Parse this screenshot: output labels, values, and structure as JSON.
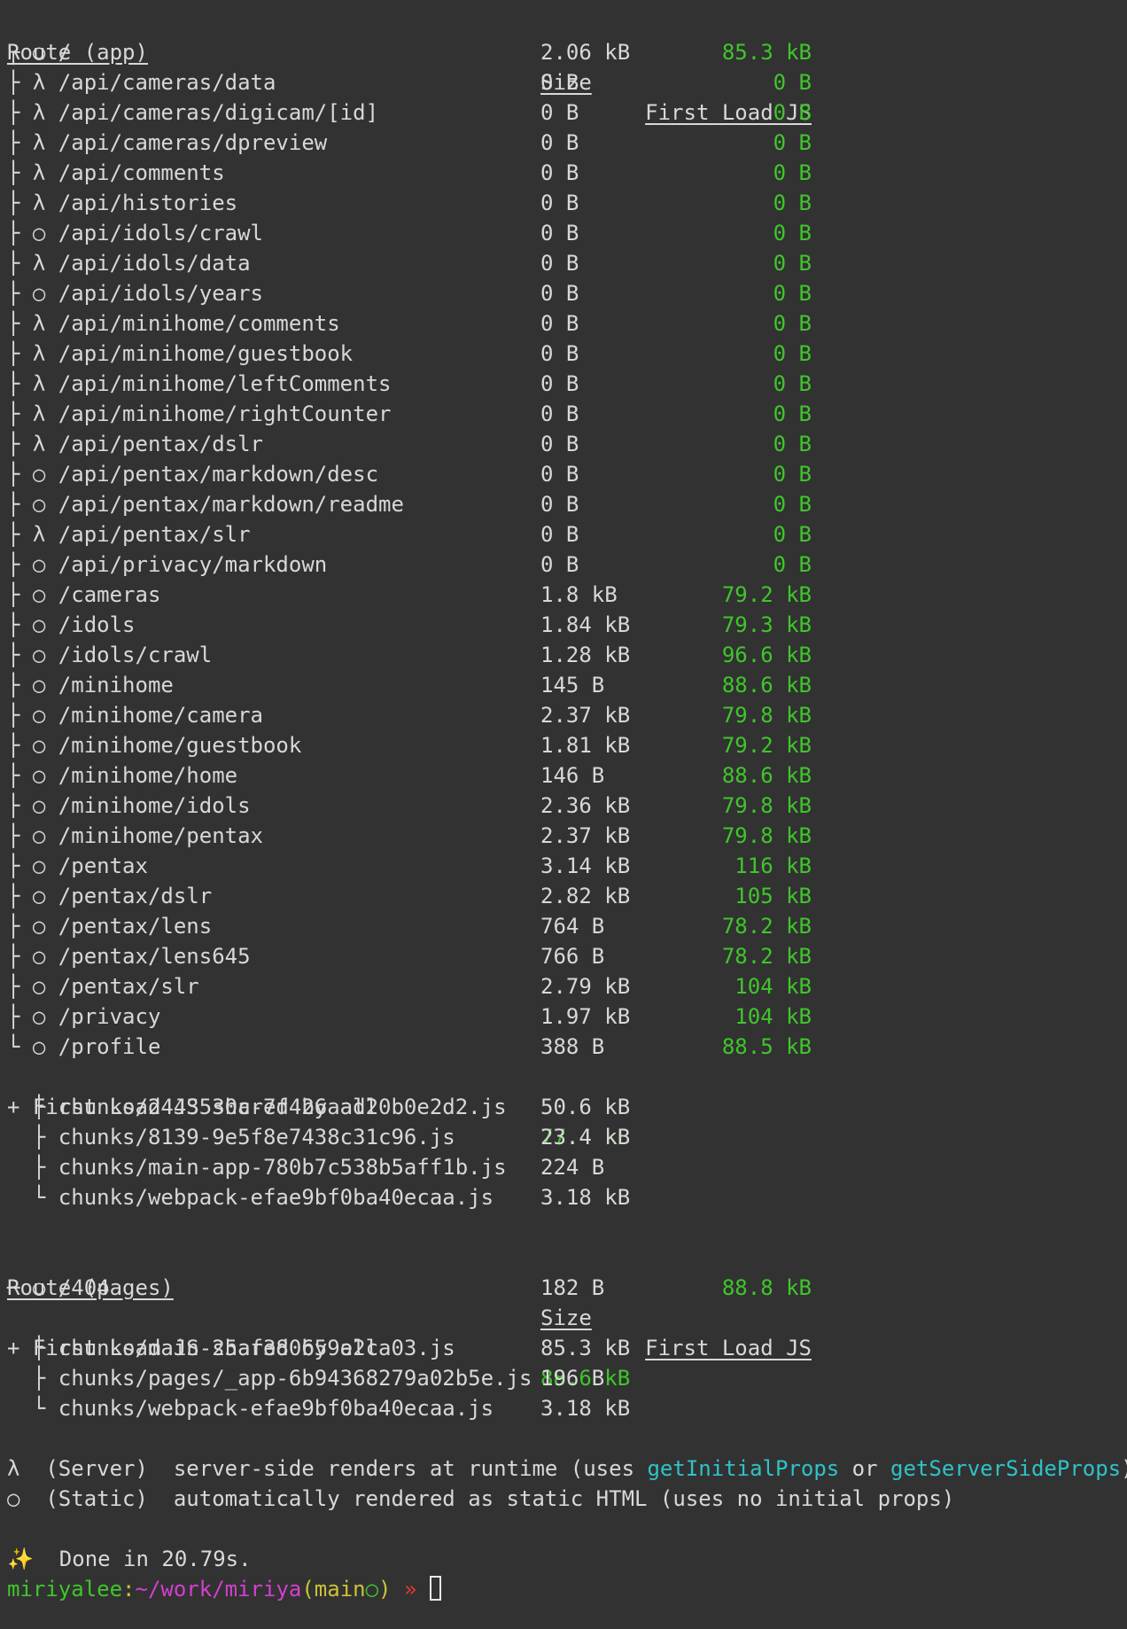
{
  "app_routes": {
    "header": {
      "route": "Route (app)",
      "size": "Size",
      "first_load": "First Load JS"
    },
    "rows": [
      {
        "prefix": "┌ ○ ",
        "path": "/",
        "size": "2.06 kB",
        "first_load": "85.3 kB"
      },
      {
        "prefix": "├ λ ",
        "path": "/api/cameras/data",
        "size": "0 B",
        "first_load": "0 B"
      },
      {
        "prefix": "├ λ ",
        "path": "/api/cameras/digicam/[id]",
        "size": "0 B",
        "first_load": "0 B"
      },
      {
        "prefix": "├ λ ",
        "path": "/api/cameras/dpreview",
        "size": "0 B",
        "first_load": "0 B"
      },
      {
        "prefix": "├ λ ",
        "path": "/api/comments",
        "size": "0 B",
        "first_load": "0 B"
      },
      {
        "prefix": "├ λ ",
        "path": "/api/histories",
        "size": "0 B",
        "first_load": "0 B"
      },
      {
        "prefix": "├ ○ ",
        "path": "/api/idols/crawl",
        "size": "0 B",
        "first_load": "0 B"
      },
      {
        "prefix": "├ λ ",
        "path": "/api/idols/data",
        "size": "0 B",
        "first_load": "0 B"
      },
      {
        "prefix": "├ ○ ",
        "path": "/api/idols/years",
        "size": "0 B",
        "first_load": "0 B"
      },
      {
        "prefix": "├ λ ",
        "path": "/api/minihome/comments",
        "size": "0 B",
        "first_load": "0 B"
      },
      {
        "prefix": "├ λ ",
        "path": "/api/minihome/guestbook",
        "size": "0 B",
        "first_load": "0 B"
      },
      {
        "prefix": "├ λ ",
        "path": "/api/minihome/leftComments",
        "size": "0 B",
        "first_load": "0 B"
      },
      {
        "prefix": "├ λ ",
        "path": "/api/minihome/rightCounter",
        "size": "0 B",
        "first_load": "0 B"
      },
      {
        "prefix": "├ λ ",
        "path": "/api/pentax/dslr",
        "size": "0 B",
        "first_load": "0 B"
      },
      {
        "prefix": "├ ○ ",
        "path": "/api/pentax/markdown/desc",
        "size": "0 B",
        "first_load": "0 B"
      },
      {
        "prefix": "├ ○ ",
        "path": "/api/pentax/markdown/readme",
        "size": "0 B",
        "first_load": "0 B"
      },
      {
        "prefix": "├ λ ",
        "path": "/api/pentax/slr",
        "size": "0 B",
        "first_load": "0 B"
      },
      {
        "prefix": "├ ○ ",
        "path": "/api/privacy/markdown",
        "size": "0 B",
        "first_load": "0 B"
      },
      {
        "prefix": "├ ○ ",
        "path": "/cameras",
        "size": "1.8 kB",
        "first_load": "79.2 kB"
      },
      {
        "prefix": "├ ○ ",
        "path": "/idols",
        "size": "1.84 kB",
        "first_load": "79.3 kB"
      },
      {
        "prefix": "├ ○ ",
        "path": "/idols/crawl",
        "size": "1.28 kB",
        "first_load": "96.6 kB"
      },
      {
        "prefix": "├ ○ ",
        "path": "/minihome",
        "size": "145 B",
        "first_load": "88.6 kB"
      },
      {
        "prefix": "├ ○ ",
        "path": "/minihome/camera",
        "size": "2.37 kB",
        "first_load": "79.8 kB"
      },
      {
        "prefix": "├ ○ ",
        "path": "/minihome/guestbook",
        "size": "1.81 kB",
        "first_load": "79.2 kB"
      },
      {
        "prefix": "├ ○ ",
        "path": "/minihome/home",
        "size": "146 B",
        "first_load": "88.6 kB"
      },
      {
        "prefix": "├ ○ ",
        "path": "/minihome/idols",
        "size": "2.36 kB",
        "first_load": "79.8 kB"
      },
      {
        "prefix": "├ ○ ",
        "path": "/minihome/pentax",
        "size": "2.37 kB",
        "first_load": "79.8 kB"
      },
      {
        "prefix": "├ ○ ",
        "path": "/pentax",
        "size": "3.14 kB",
        "first_load": "116 kB"
      },
      {
        "prefix": "├ ○ ",
        "path": "/pentax/dslr",
        "size": "2.82 kB",
        "first_load": "105 kB"
      },
      {
        "prefix": "├ ○ ",
        "path": "/pentax/lens",
        "size": "764 B",
        "first_load": "78.2 kB"
      },
      {
        "prefix": "├ ○ ",
        "path": "/pentax/lens645",
        "size": "766 B",
        "first_load": "78.2 kB"
      },
      {
        "prefix": "├ ○ ",
        "path": "/pentax/slr",
        "size": "2.79 kB",
        "first_load": "104 kB"
      },
      {
        "prefix": "├ ○ ",
        "path": "/privacy",
        "size": "1.97 kB",
        "first_load": "104 kB"
      },
      {
        "prefix": "└ ○ ",
        "path": "/profile",
        "size": "388 B",
        "first_load": "88.5 kB"
      }
    ],
    "shared": {
      "label": "+ First Load JS shared by all",
      "size": "77.4 kB"
    },
    "chunks": [
      {
        "prefix": "  ├ ",
        "name": "chunks/2443530c-7f426aad20b0e2d2.js",
        "size": "50.6 kB"
      },
      {
        "prefix": "  ├ ",
        "name": "chunks/8139-9e5f8e7438c31c96.js",
        "size": "23.4 kB"
      },
      {
        "prefix": "  ├ ",
        "name": "chunks/main-app-780b7c538b5aff1b.js",
        "size": "224 B"
      },
      {
        "prefix": "  └ ",
        "name": "chunks/webpack-efae9bf0ba40ecaa.js",
        "size": "3.18 kB"
      }
    ]
  },
  "pages_routes": {
    "header": {
      "route": "Route (pages)",
      "size": "Size",
      "first_load": "First Load JS"
    },
    "rows": [
      {
        "prefix": "─ ○ ",
        "path": "/404",
        "size": "182 B",
        "first_load": "88.8 kB"
      }
    ],
    "shared": {
      "label": "+ First Load JS shared by all",
      "size": "88.6 kB"
    },
    "chunks": [
      {
        "prefix": "  ├ ",
        "name": "chunks/main-25af380659e2ca03.js",
        "size": "85.3 kB"
      },
      {
        "prefix": "  ├ ",
        "name": "chunks/pages/_app-6b94368279a02b5e.js",
        "size": "196 B"
      },
      {
        "prefix": "  └ ",
        "name": "chunks/webpack-efae9bf0ba40ecaa.js",
        "size": "3.18 kB"
      }
    ]
  },
  "legend": {
    "server_symbol": "λ",
    "server_label": "(Server)",
    "server_desc_pre": "server-side renders at runtime (uses ",
    "server_fn1": "getInitialProps",
    "server_or": " or ",
    "server_fn2": "getServerSideProps",
    "server_desc_post": ")",
    "static_symbol": "○",
    "static_label": "(Static)",
    "static_desc": "automatically rendered as static HTML (uses no initial props)"
  },
  "done": {
    "sparkle": "✨",
    "text": "Done in 20.79s."
  },
  "prompt": {
    "user": "miriyalee",
    "colon": ":",
    "path": "~/work/miriya",
    "branch_open": "(",
    "branch": "main",
    "branch_status": "○",
    "branch_close": ")",
    "arrow": "»"
  },
  "colors": {
    "background": "#323232",
    "text": "#d8d8d8",
    "green": "#3fc62b",
    "cyan": "#2ec3c8",
    "magenta": "#d43fd2",
    "yellow": "#cbc23a",
    "red": "#e03a2f"
  }
}
